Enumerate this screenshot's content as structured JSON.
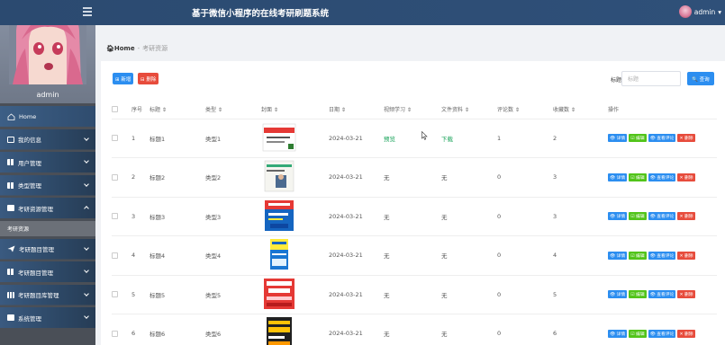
{
  "header": {
    "title": "基于微信小程序的在线考研刷题系统",
    "username": "admin"
  },
  "sidebar": {
    "profile_name": "admin",
    "items": [
      {
        "label": "Home",
        "icon": "home-icon",
        "expand": ""
      },
      {
        "label": "我的信息",
        "icon": "card-icon",
        "expand": "down"
      },
      {
        "label": "用户管理",
        "icon": "grid-icon",
        "expand": "down"
      },
      {
        "label": "类型管理",
        "icon": "grid-icon",
        "expand": "down"
      },
      {
        "label": "考研资源管理",
        "icon": "card-icon",
        "expand": "up"
      },
      {
        "label": "考研资源",
        "sub": true
      },
      {
        "label": "考研题目管理",
        "icon": "send-icon",
        "expand": "down"
      },
      {
        "label": "考研题目管理",
        "icon": "grid-icon",
        "expand": "down"
      },
      {
        "label": "考研题目库管理",
        "icon": "bar-icon",
        "expand": "down"
      },
      {
        "label": "系统管理",
        "icon": "card-icon",
        "expand": "down"
      }
    ]
  },
  "breadcrumb": {
    "home": "Home",
    "sep": "-",
    "current": "考研资源"
  },
  "toolbar": {
    "add_label": "⊞ 新增",
    "delete_label": "⊟ 删除",
    "search_label": "标题",
    "search_placeholder": "标题",
    "search_button": "🔍 查询"
  },
  "table": {
    "columns": [
      "",
      "序号",
      "标题 ⇕",
      "类型 ⇕",
      "封面 ⇕",
      "日期 ⇕",
      "视频学习 ⇕",
      "文件资料 ⇕",
      "评论数 ⇕",
      "收藏数 ⇕",
      "操作"
    ],
    "rows": [
      {
        "no": "1",
        "title": "标题1",
        "type": "类型1",
        "cover": "cover-1",
        "date": "2024-03-21",
        "video": "预览",
        "file": "下载",
        "comments": "1",
        "favs": "2"
      },
      {
        "no": "2",
        "title": "标题2",
        "type": "类型2",
        "cover": "cover-2",
        "date": "2024-03-21",
        "video": "无",
        "file": "无",
        "comments": "0",
        "favs": "3"
      },
      {
        "no": "3",
        "title": "标题3",
        "type": "类型3",
        "cover": "cover-3",
        "date": "2024-03-21",
        "video": "无",
        "file": "无",
        "comments": "0",
        "favs": "3"
      },
      {
        "no": "4",
        "title": "标题4",
        "type": "类型4",
        "cover": "cover-4",
        "date": "2024-03-21",
        "video": "无",
        "file": "无",
        "comments": "0",
        "favs": "4"
      },
      {
        "no": "5",
        "title": "标题5",
        "type": "类型5",
        "cover": "cover-5",
        "date": "2024-03-21",
        "video": "无",
        "file": "无",
        "comments": "0",
        "favs": "5"
      },
      {
        "no": "6",
        "title": "标题6",
        "type": "类型6",
        "cover": "cover-6",
        "date": "2024-03-21",
        "video": "无",
        "file": "无",
        "comments": "0",
        "favs": "6"
      }
    ],
    "actions": [
      "👁 详情",
      "☑ 编辑",
      "👁 查看评论",
      "✕ 删除"
    ]
  },
  "colors": {
    "accent": "#2c8ef0",
    "danger": "#e74c3c",
    "success": "#52c41a",
    "nav": "#3d5f86"
  }
}
